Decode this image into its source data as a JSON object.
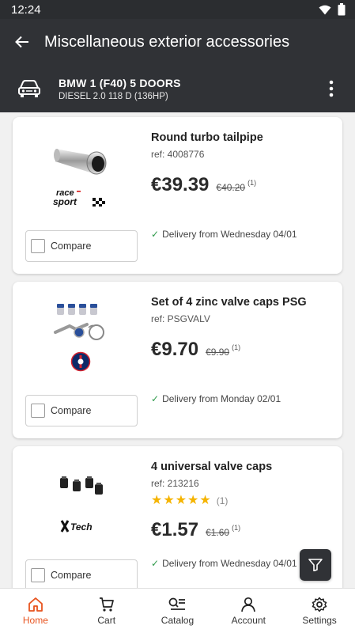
{
  "status_bar": {
    "time": "12:24"
  },
  "header": {
    "title": "Miscellaneous exterior accessories"
  },
  "vehicle": {
    "model": "BMW 1 (F40) 5 DOORS",
    "engine": "DIESEL 2.0 118 D (136HP)"
  },
  "products": [
    {
      "title": "Round turbo tailpipe",
      "ref": "ref: 4008776",
      "price": "€39.39",
      "old_price": "€40.20",
      "footnote": "(1)",
      "delivery": "Delivery from Wednesday 04/01",
      "compare": "Compare",
      "brand": "race sport",
      "image_icon": "tailpipe-image"
    },
    {
      "title": "Set of 4 zinc valve caps PSG",
      "ref": "ref: PSGVALV",
      "price": "€9.70",
      "old_price": "€9.90",
      "footnote": "(1)",
      "delivery": "Delivery from Monday 02/01",
      "compare": "Compare",
      "brand": "PSG",
      "image_icon": "valve-caps-keyring-image"
    },
    {
      "title": "4 universal valve caps",
      "ref": "ref: 213216",
      "rating": 5,
      "rating_count": "(1)",
      "price": "€1.57",
      "old_price": "€1.60",
      "footnote": "(1)",
      "delivery": "Delivery from Wednesday 04/01",
      "compare": "Compare",
      "brand": "XTech",
      "image_icon": "valve-caps-image"
    }
  ],
  "bottom_nav": [
    {
      "label": "Home",
      "icon": "home-icon",
      "active": true
    },
    {
      "label": "Cart",
      "icon": "cart-icon",
      "active": false
    },
    {
      "label": "Catalog",
      "icon": "catalog-icon",
      "active": false
    },
    {
      "label": "Account",
      "icon": "account-icon",
      "active": false
    },
    {
      "label": "Settings",
      "icon": "gear-icon",
      "active": false
    }
  ],
  "colors": {
    "header": "#303236",
    "accent": "#e8531e",
    "star": "#f5b400",
    "check": "#2e9a4a"
  }
}
